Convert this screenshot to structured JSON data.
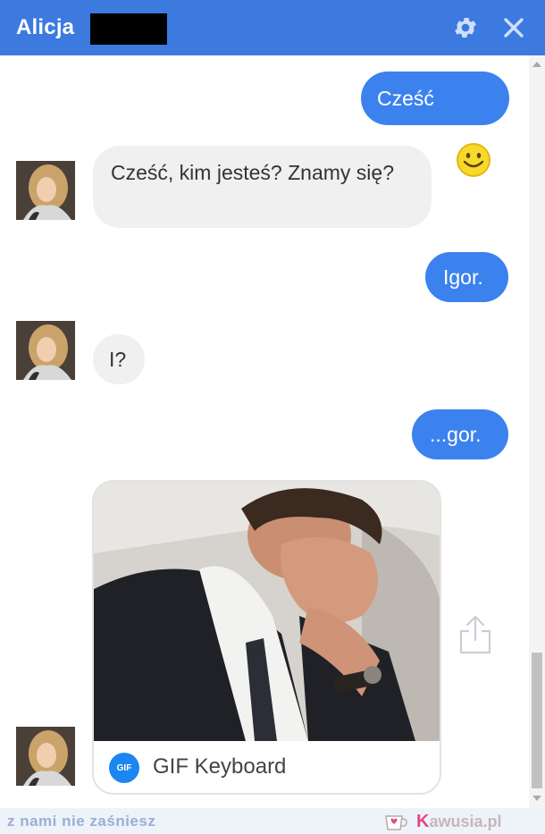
{
  "header": {
    "contact_name": "Alicja",
    "background": "#3c7ae0",
    "icons": [
      "gear-icon",
      "close-icon"
    ]
  },
  "messages": [
    {
      "direction": "outgoing",
      "text": "Cześć",
      "emoji": "smiley"
    },
    {
      "direction": "incoming",
      "text": "Cześć, kim jesteś? Znamy się?"
    },
    {
      "direction": "outgoing",
      "text": "Igor."
    },
    {
      "direction": "incoming",
      "text": "I?"
    },
    {
      "direction": "outgoing",
      "text": "...gor."
    },
    {
      "direction": "incoming",
      "type": "gif",
      "source_label": "GIF Keyboard",
      "badge": "GIF"
    }
  ],
  "colors": {
    "outgoing_bubble": "#3b82ee",
    "incoming_bubble": "#f0f0f0",
    "gif_badge": "#1c86f0"
  },
  "footer": {
    "slogan": "z nami nie zaśniesz",
    "logo_initial": "K",
    "logo_rest": "awusia",
    "logo_suffix": ".pl"
  }
}
